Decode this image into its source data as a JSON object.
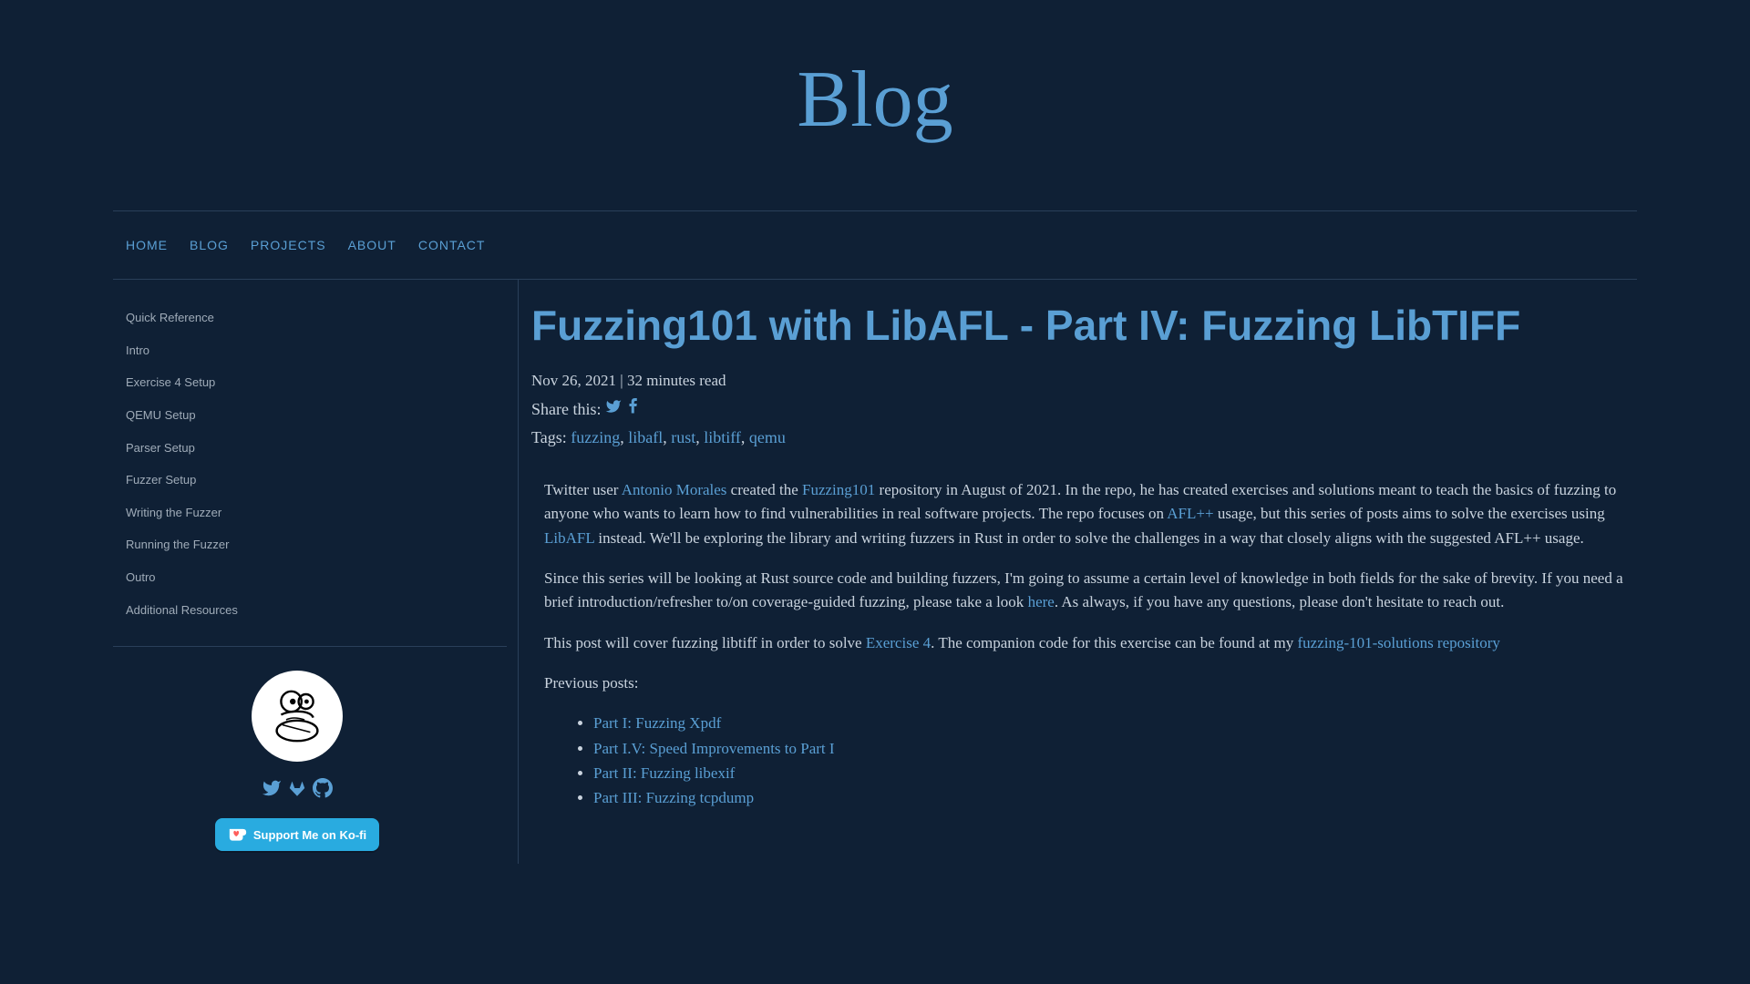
{
  "page": {
    "title": "Blog"
  },
  "nav": {
    "items": [
      {
        "label": "HOME"
      },
      {
        "label": "BLOG"
      },
      {
        "label": "PROJECTS"
      },
      {
        "label": "ABOUT"
      },
      {
        "label": "CONTACT"
      }
    ]
  },
  "toc": {
    "items": [
      {
        "label": "Quick Reference"
      },
      {
        "label": "Intro"
      },
      {
        "label": "Exercise 4 Setup"
      },
      {
        "label": "QEMU Setup"
      },
      {
        "label": "Parser Setup"
      },
      {
        "label": "Fuzzer Setup"
      },
      {
        "label": "Writing the Fuzzer"
      },
      {
        "label": "Running the Fuzzer"
      },
      {
        "label": "Outro"
      },
      {
        "label": "Additional Resources"
      }
    ]
  },
  "kofi": {
    "label": "Support Me on Ko-fi"
  },
  "post": {
    "title": "Fuzzing101 with LibAFL - Part IV: Fuzzing LibTIFF",
    "date": "Nov 26, 2021",
    "read_time": "32 minutes read",
    "share_label": "Share this:",
    "tags_label": "Tags:",
    "tags": [
      {
        "label": "fuzzing"
      },
      {
        "label": "libafl"
      },
      {
        "label": "rust"
      },
      {
        "label": "libtiff"
      },
      {
        "label": "qemu"
      }
    ]
  },
  "body": {
    "p1_a": "Twitter user ",
    "p1_link1": "Antonio Morales",
    "p1_b": " created the ",
    "p1_link2": "Fuzzing101",
    "p1_c": " repository in August of 2021. In the repo, he has created exercises and solutions meant to teach the basics of fuzzing to anyone who wants to learn how to find vulnerabilities in real software projects. The repo focuses on ",
    "p1_link3": "AFL++",
    "p1_d": " usage, but this series of posts aims to solve the exercises using ",
    "p1_link4": "LibAFL",
    "p1_e": " instead. We'll be exploring the library and writing fuzzers in Rust in order to solve the challenges in a way that closely aligns with the suggested AFL++ usage.",
    "p2_a": "Since this series will be looking at Rust source code and building fuzzers, I'm going to assume a certain level of knowledge in both fields for the sake of brevity. If you need a brief introduction/refresher to/on coverage-guided fuzzing, please take a look ",
    "p2_link1": "here",
    "p2_b": ". As always, if you have any questions, please don't hesitate to reach out.",
    "p3_a": "This post will cover fuzzing libtiff in order to solve ",
    "p3_link1": "Exercise 4",
    "p3_b": ". The companion code for this exercise can be found at my ",
    "p3_link2": "fuzzing-101-solutions repository",
    "p4": "Previous posts:",
    "list": [
      {
        "label": "Part I: Fuzzing Xpdf"
      },
      {
        "label": "Part I.V: Speed Improvements to Part I"
      },
      {
        "label": "Part II: Fuzzing libexif"
      },
      {
        "label": "Part III: Fuzzing tcpdump"
      }
    ]
  }
}
